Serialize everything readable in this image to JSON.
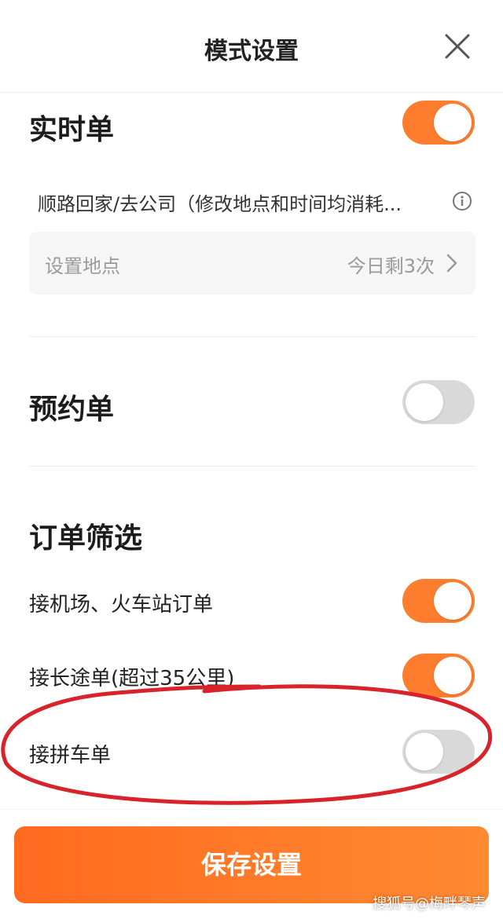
{
  "header": {
    "title": "模式设置"
  },
  "realtime": {
    "title": "实时单",
    "enabled": true,
    "route_text": "顺路回家/去公司（修改地点和时间均消耗...",
    "location_label": "设置地点",
    "location_remain": "今日剩3次"
  },
  "reservation": {
    "title": "预约单",
    "enabled": false
  },
  "filter": {
    "title": "订单筛选",
    "items": [
      {
        "label": "接机场、火车站订单",
        "enabled": true
      },
      {
        "label": "接长途单(超过35公里)",
        "enabled": true
      },
      {
        "label": "接拼车单",
        "enabled": false
      }
    ]
  },
  "footer": {
    "save_label": "保存设置",
    "watermark": "搜狐号@梅畔琴声"
  },
  "colors": {
    "accent": "#ff7d2e",
    "toggle_off": "#d9d9d9",
    "annotation": "#d8232a"
  }
}
